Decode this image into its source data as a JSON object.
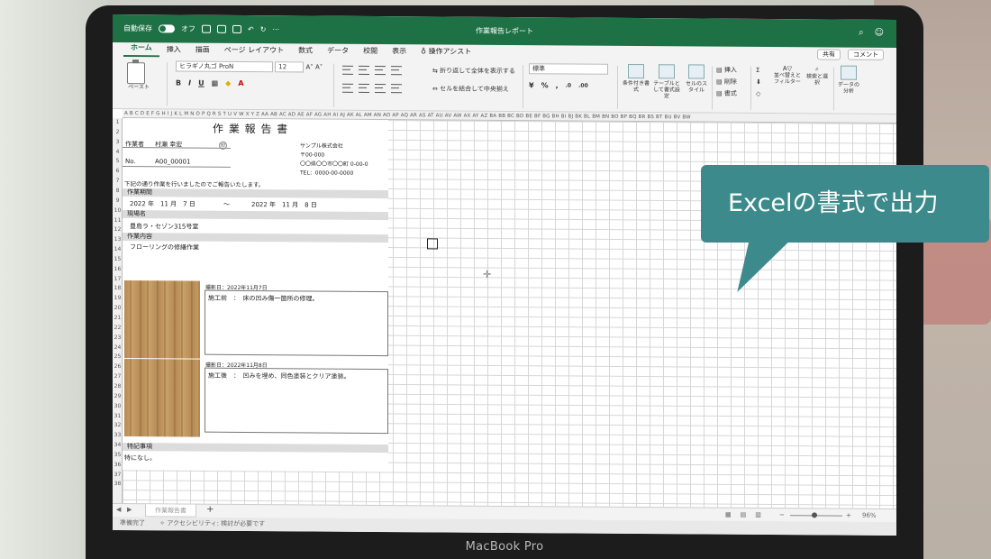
{
  "window": {
    "title": "作業報告レポート",
    "autosave_label": "自動保存",
    "autosave_state": "オフ"
  },
  "ribbon": {
    "tabs": [
      "ホーム",
      "挿入",
      "描画",
      "ページ レイアウト",
      "数式",
      "データ",
      "校閲",
      "表示"
    ],
    "tell_me": "操作アシスト",
    "share_label": "共有",
    "comment_label": "コメント",
    "paste_label": "ペースト",
    "font_name": "ヒラギノ丸ゴ ProN",
    "font_size": "12",
    "wrap_label": "折り返して全体を表示する",
    "merge_label": "セルを結合して中央揃え",
    "number_format": "標準",
    "cond_format": "条件付き書式",
    "table_format": "テーブルとして書式設定",
    "cell_style": "セルのスタイル",
    "insert": "挿入",
    "delete": "削除",
    "format": "書式",
    "sort_filter": "並べ替えとフィルター",
    "find_select": "検索と選択",
    "data_analysis": "データの分析"
  },
  "columns": "A B C D E F G H I J K L M N O P Q R S T U V W X Y Z AA AB AC AD AE AF AG AH AI AJ AK AL AM AN AO AP AQ AR AS AT AU AV AW AX AY AZ BA BB BC BD BE BF BG BH BI BJ BK BL BM BN BO BP BQ BR BS BT BU BV BW",
  "rows": [
    "1",
    "2",
    "3",
    "4",
    "5",
    "6",
    "7",
    "8",
    "9",
    "10",
    "11",
    "12",
    "13",
    "14",
    "15",
    "16",
    "17",
    "18",
    "19",
    "20",
    "21",
    "22",
    "23",
    "24",
    "25",
    "26",
    "27",
    "28",
    "29",
    "30",
    "31",
    "32",
    "33",
    "34",
    "35",
    "36",
    "37",
    "38"
  ],
  "report": {
    "title": "作 業 報 告 書",
    "worker_label": "作業者",
    "worker_name": "村瀬 幸宏",
    "seal": "印",
    "no_label": "No.",
    "no_value": "A00_00001",
    "company": "サンプル株式会社",
    "postal": "〒00-000",
    "address": "〇〇県〇〇市〇〇町 0-00-0",
    "tel": "TEL：0000-00-0000",
    "intro": "下記の通り作業を行いましたのでご報告いたします。",
    "period_label": "作業期間",
    "period_start": "2022 年　11 月　7 日",
    "period_sep": "〜",
    "period_end": "2022 年　11 月　8 日",
    "site_label": "現場名",
    "site_value": "豊島ラ・セゾン315号室",
    "content_label": "作業内容",
    "content_value": "フローリングの修繕作業",
    "photo1_date": "撮影日：2022年11月7日",
    "photo1_note": "施工前　：　床の凹み傷一箇所の修理。",
    "photo2_date": "撮影日：2022年11月8日",
    "photo2_note": "施工後　：　凹みを埋め、同色塗装とクリア塗装。",
    "remarks_label": "特記事項",
    "remarks_value": "特になし。"
  },
  "sheet_tab": "作業報告書",
  "status": {
    "ready": "準備完了",
    "accessibility": "アクセシビリティ: 検討が必要です",
    "zoom": "96%"
  },
  "callout_text": "Excelの書式で出力",
  "bezel_brand": "MacBook Pro"
}
